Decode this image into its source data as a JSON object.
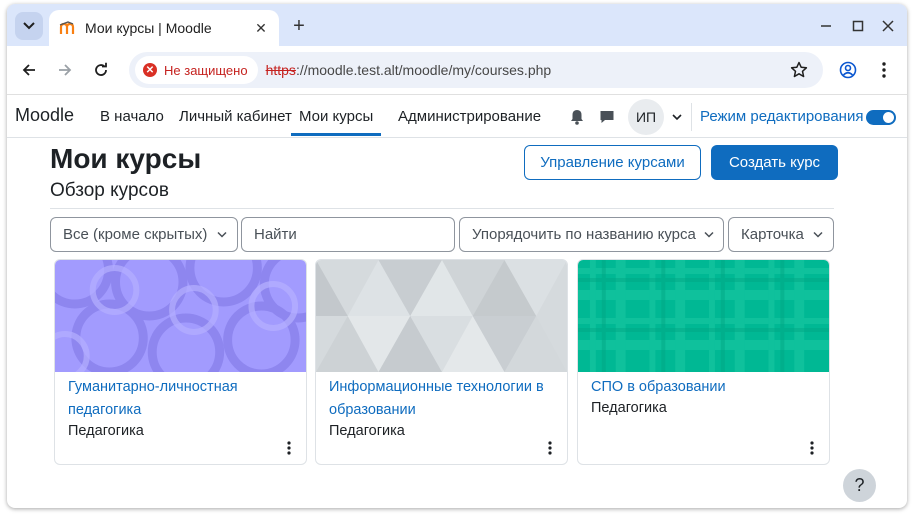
{
  "browser": {
    "tab_title": "Мои курсы | Moodle",
    "new_tab_label": "+",
    "security_label": "Не защищено",
    "url_scheme": "https",
    "url_rest": "://moodle.test.alt/moodle/my/courses.php",
    "icons": [
      "tab-search-icon",
      "moodle-favicon-icon",
      "close-icon",
      "minimize-icon",
      "maximize-icon",
      "back-icon",
      "forward-icon",
      "reload-icon",
      "warning-icon",
      "star-icon",
      "profile-icon",
      "more-vert-icon"
    ]
  },
  "navbar": {
    "brand": "Moodle",
    "links": [
      "В начало",
      "Личный кабинет",
      "Мои курсы",
      "Администрирование"
    ],
    "active_link": "Мои курсы",
    "avatar_initials": "ИП",
    "edit_mode_label": "Режим редактирования",
    "edit_mode_on": true
  },
  "page": {
    "title": "Мои курсы",
    "subtitle": "Обзор курсов",
    "manage_courses_label": "Управление курсами",
    "create_course_label": "Создать курс",
    "filters": {
      "grouping": "Все (кроме скрытых)",
      "search_placeholder": "Найти",
      "sort": "Упорядочить по названию курса",
      "view": "Карточка"
    }
  },
  "courses": [
    {
      "name": "Гуманитарно-личностная педагогика",
      "category": "Педагогика",
      "pattern": "circles",
      "color": "#a29bfe"
    },
    {
      "name": "Информационные технологии в образовании",
      "category": "Педагогика",
      "pattern": "triangles",
      "color": "#d5dadd"
    },
    {
      "name": "СПО в образовании",
      "category": "Педагогика",
      "pattern": "plaid",
      "color": "#00b894"
    }
  ],
  "help_label": "?",
  "colors": {
    "accent": "#0f6cbf",
    "tabstrip": "#dbe6fb",
    "danger": "#c5221f"
  }
}
